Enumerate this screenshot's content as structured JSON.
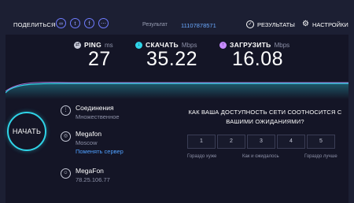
{
  "header": {
    "share_label": "ПОДЕЛИТЬСЯ",
    "social_icons": [
      "link-icon",
      "twitter-icon",
      "facebook-icon",
      "more-icon"
    ],
    "result_label": "Результат",
    "result_id": "11107878571",
    "results_button": "РЕЗУЛЬТАТЫ",
    "settings_button": "НАСТРОЙКИ"
  },
  "metrics": {
    "ping": {
      "name": "PING",
      "unit": "ms",
      "value": "27",
      "color": "#ffffff"
    },
    "download": {
      "name": "СКАЧАТЬ",
      "unit": "Mbps",
      "value": "35.22",
      "color": "#2fd4e8"
    },
    "upload": {
      "name": "ЗАГРУЗИТЬ",
      "unit": "Mbps",
      "value": "16.08",
      "color": "#c78bff"
    }
  },
  "start_button": "НАЧАТЬ",
  "connection": {
    "title": "Соединения",
    "subtitle": "Множественное"
  },
  "server": {
    "title": "Megafon",
    "subtitle": "Moscow",
    "change_link": "Поменять сервер"
  },
  "provider": {
    "title": "MegaFon",
    "ip": "78.25.106.77"
  },
  "survey": {
    "question": "КАК ВАША ДОСТУПНОСТЬ СЕТИ СООТНОСИТСЯ С ВАШИМИ ОЖИДАНИЯМИ?",
    "options": [
      "1",
      "2",
      "3",
      "4",
      "5"
    ],
    "label_low": "Гораздо хуже",
    "label_mid": "Как и ожидалось",
    "label_high": "Гораздо лучше"
  },
  "colors": {
    "accent": "#2fd4e8",
    "upload": "#c78bff",
    "link": "#4fa0ff",
    "background": "#1c1f33"
  }
}
